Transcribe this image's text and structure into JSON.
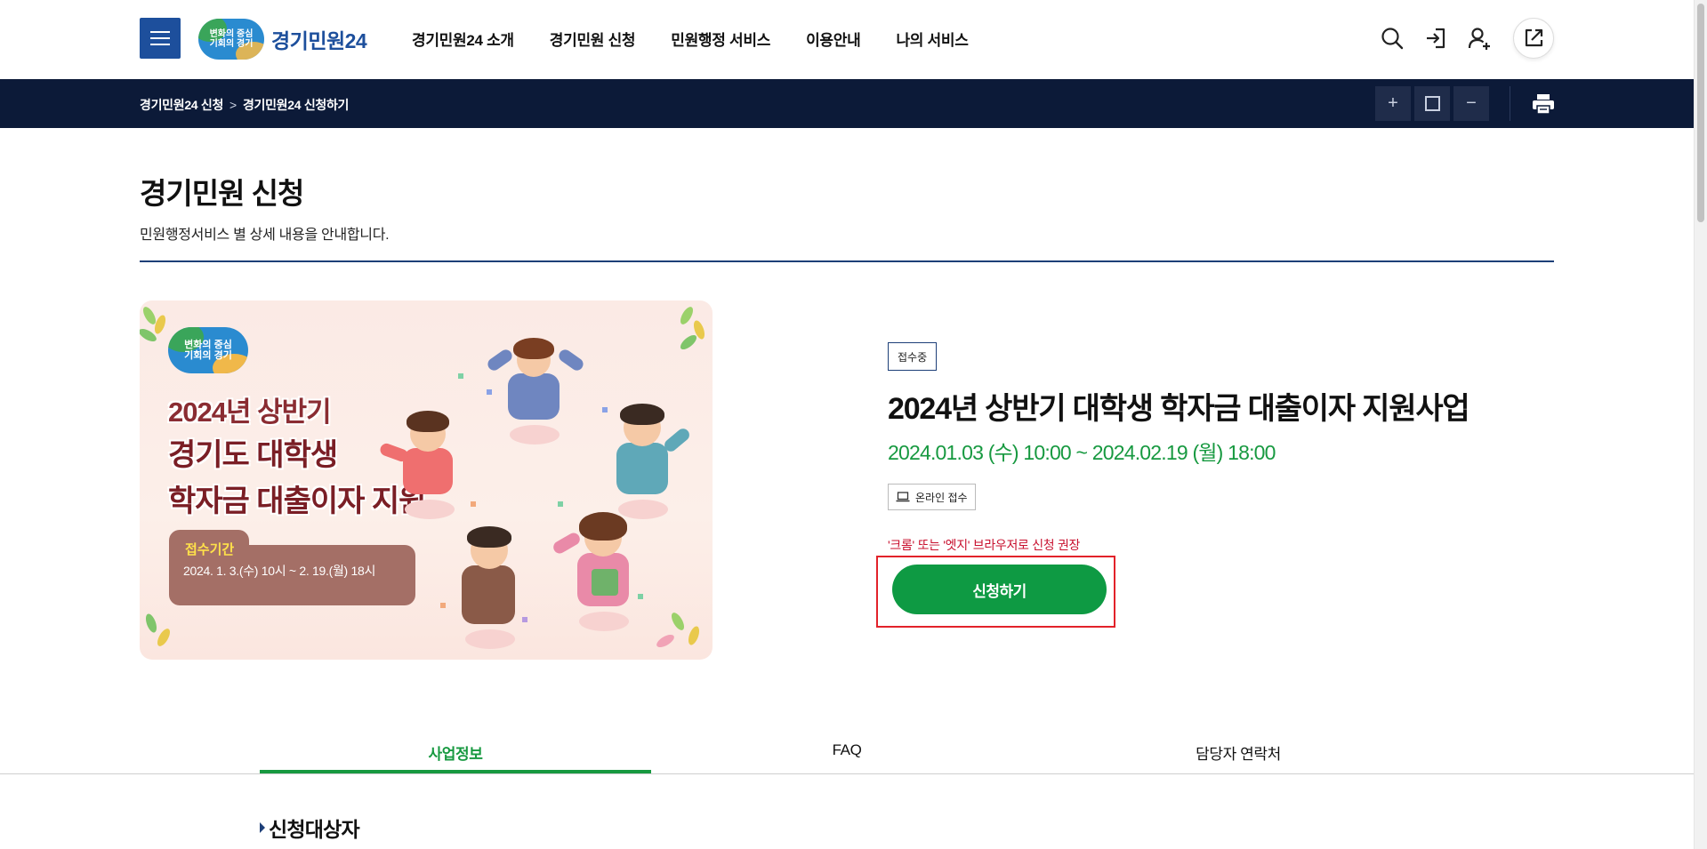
{
  "header": {
    "menu_icon": "hamburger-icon",
    "logo_badge_line1": "변화의 중심",
    "logo_badge_line2": "기회의 경기",
    "logo_text": "경기민원24",
    "nav": [
      "경기민원24 소개",
      "경기민원 신청",
      "민원행정 서비스",
      "이용안내",
      "나의 서비스"
    ],
    "util_icons": [
      "search-icon",
      "login-icon",
      "user-icon",
      "share-icon"
    ]
  },
  "subbar": {
    "breadcrumb": [
      "경기민원24 신청",
      "경기민원24 신청하기"
    ],
    "breadcrumb_sep": ">",
    "zoom_in": "+",
    "zoom_out": "−",
    "print_icon": "print-icon"
  },
  "page": {
    "title": "경기민원 신청",
    "description": "민원행정서비스 별 상세 내용을 안내합니다."
  },
  "banner": {
    "logo_line1": "변화의 중심",
    "logo_line2": "기회의 경기",
    "line1": "2024년 상반기",
    "line2": "경기도 대학생",
    "line3": "학자금 대출이자 지원",
    "period_label": "접수기간",
    "period_value": "2024. 1. 3.(수) 10시 ~ 2. 19.(월) 18시"
  },
  "program": {
    "status": "접수중",
    "title": "2024년 상반기 대학생 학자금 대출이자 지원사업",
    "period": "2024.01.03 (수) 10:00 ~ 2024.02.19 (월) 18:00",
    "channel_icon": "laptop-icon",
    "channel": "온라인 접수",
    "notice": "'크롬' 또는 '엣지' 브라우저로 신청 권장",
    "apply_label": "신청하기"
  },
  "tabs": [
    {
      "label": "사업정보",
      "active": true
    },
    {
      "label": "FAQ",
      "active": false
    },
    {
      "label": "담당자 연락처",
      "active": false
    }
  ],
  "section": {
    "title": "신청대상자"
  },
  "colors": {
    "brand_blue": "#1d4f9c",
    "navy_bar": "#0c1a38",
    "accent_green": "#0e9a43",
    "notice_red": "#c8102e",
    "highlight_red": "#e2222a"
  }
}
